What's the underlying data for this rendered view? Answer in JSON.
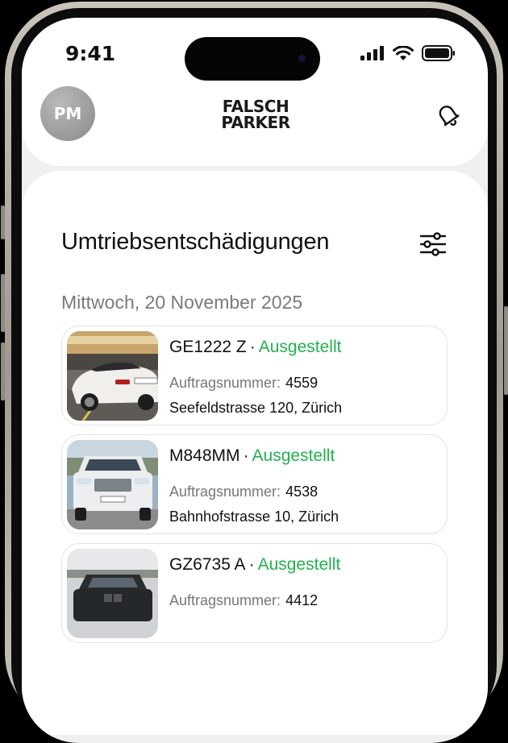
{
  "status_bar": {
    "time": "9:41"
  },
  "header": {
    "avatar_initials": "PM",
    "logo_line1": "FALSCH",
    "logo_line2": "PARKER"
  },
  "main": {
    "title": "Umtriebsentschädigungen",
    "date_heading": "Mittwoch, 20 November 2025",
    "items": [
      {
        "plate": "GE1222 Z",
        "status": "Ausgestellt",
        "order_label": "Auftragsnummer:",
        "order_number": "4559",
        "address": "Seefeldstrasse 120, Zürich"
      },
      {
        "plate": "M848MM",
        "status": "Ausgestellt",
        "order_label": "Auftragsnummer:",
        "order_number": "4538",
        "address": "Bahnhofstrasse 10, Zürich"
      },
      {
        "plate": "GZ6735 A",
        "status": "Ausgestellt",
        "order_label": "Auftragsnummer:",
        "order_number": "4412",
        "address": ""
      }
    ]
  },
  "colors": {
    "status_green": "#22b24c",
    "accent_dark": "#111111"
  }
}
